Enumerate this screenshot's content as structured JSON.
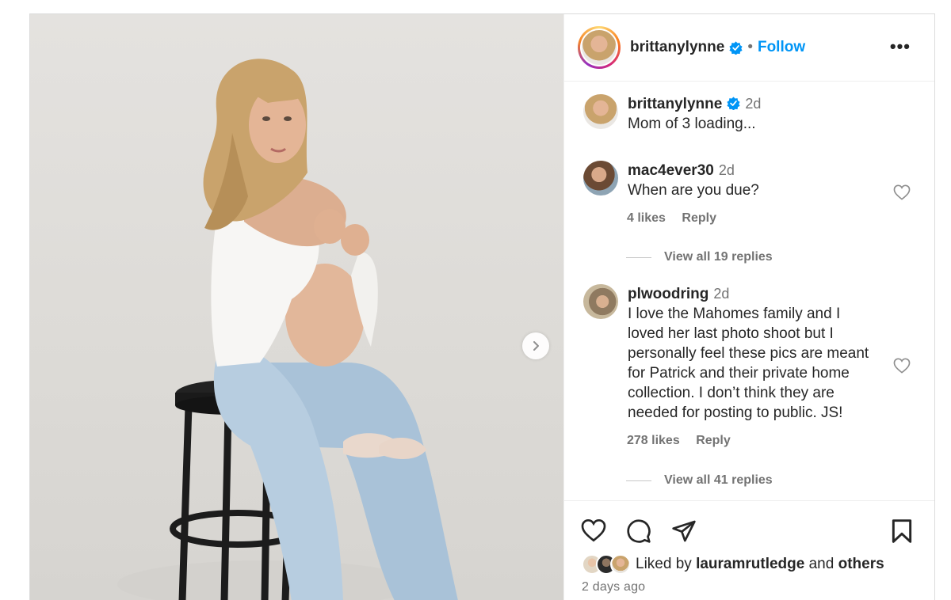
{
  "header": {
    "username": "brittanylynne",
    "separator": "•",
    "follow_label": "Follow",
    "more_label": "•••"
  },
  "caption": {
    "username": "brittanylynne",
    "time": "2d",
    "text": "Mom of 3 loading..."
  },
  "comments": [
    {
      "username": "mac4ever30",
      "time": "2d",
      "lines": [
        "When are you due?"
      ],
      "likes": "4 likes",
      "reply_label": "Reply",
      "view_replies": "View all 19 replies"
    },
    {
      "username": "plwoodring",
      "time": "2d",
      "lines": [
        "I love the Mahomes family and I",
        "loved her last photo shoot but I",
        "personally feel these pics are meant",
        "for Patrick and their private home",
        "collection. I don’t think they are",
        "needed for posting to public. JS!"
      ],
      "likes": "278 likes",
      "reply_label": "Reply",
      "view_replies": "View all 41 replies"
    }
  ],
  "footer": {
    "liked_by_prefix": "Liked by",
    "liked_by_user": "lauramrutledge",
    "liked_by_and": "and",
    "liked_by_others": "others",
    "date": "2 days ago"
  },
  "icons": {
    "heart": "heart-icon",
    "comment": "comment-icon",
    "share": "share-icon",
    "bookmark": "bookmark-icon",
    "next": "chevron-right-icon",
    "verified": "verified-badge-icon"
  },
  "colors": {
    "follow": "#0095f6",
    "verified": "#0095f6",
    "muted": "#737373",
    "text": "#262626"
  }
}
